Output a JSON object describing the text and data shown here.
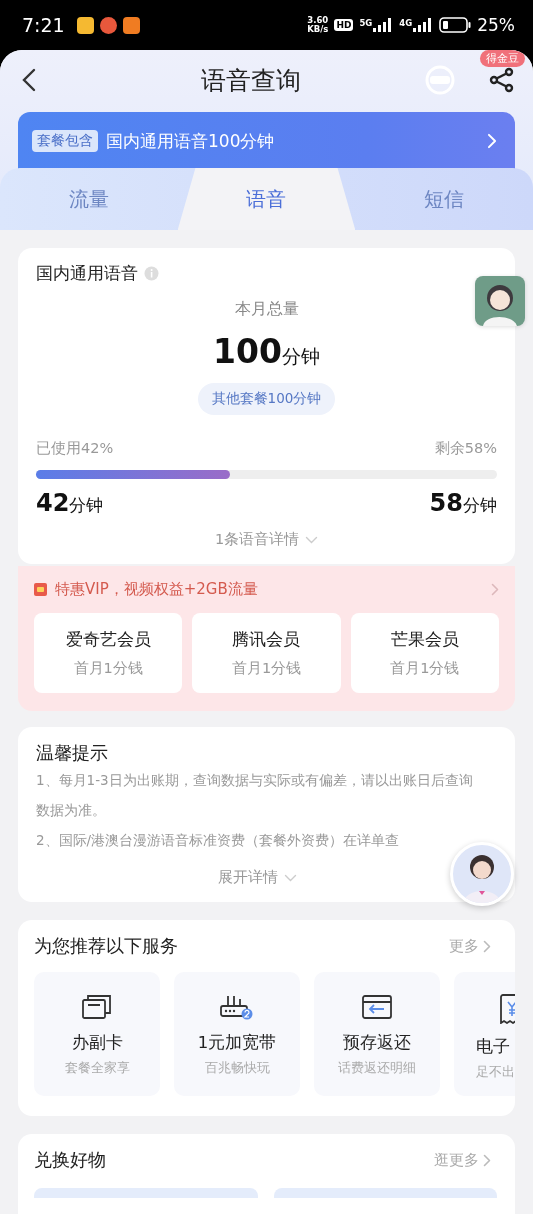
{
  "status_bar": {
    "time": "7:21",
    "speed_value": "3.60",
    "speed_unit": "KB/s",
    "hd": "HD",
    "networks": [
      "5G",
      "4G"
    ],
    "battery": "25%"
  },
  "header": {
    "title": "语音查询",
    "badge": "得金豆"
  },
  "banner": {
    "tag": "套餐包含",
    "text": "国内通用语音100分钟"
  },
  "tabs": [
    {
      "label": "流量",
      "selected": false
    },
    {
      "label": "语音",
      "selected": true
    },
    {
      "label": "短信",
      "selected": false
    }
  ],
  "usage": {
    "title": "国内通用语音",
    "total_label": "本月总量",
    "total_value": "100",
    "total_unit": "分钟",
    "bubble": "其他套餐100分钟",
    "used_label": "已使用42%",
    "left_label": "剩余58%",
    "level": 0.42,
    "used_value": "42",
    "used_unit": "分钟",
    "left_value": "58",
    "left_unit": "分钟",
    "details": "1条语音详情"
  },
  "promo": {
    "title": "特惠VIP，视频权益+2GB流量",
    "offers": [
      {
        "name": "爱奇艺会员",
        "price": "首月1分钱"
      },
      {
        "name": "腾讯会员",
        "price": "首月1分钱"
      },
      {
        "name": "芒果会员",
        "price": "首月1分钱"
      }
    ]
  },
  "tips": {
    "title": "温馨提示",
    "lines": [
      "1、每月1-3日为出账期，查询数据与实际或有偏差，请以出账日后查询数据为准。",
      "2、国际/港澳台漫游语音标准资费（套餐外资费）在详单查"
    ],
    "expand": "展开详情"
  },
  "services": {
    "title": "为您推荐以下服务",
    "more": "更多",
    "items": [
      {
        "kind": "cards",
        "name": "办副卡",
        "sub": "套餐全家享"
      },
      {
        "kind": "router",
        "name": "1元加宽带",
        "sub": "百兆畅快玩"
      },
      {
        "kind": "refund",
        "name": "预存返还",
        "sub": "话费返还明细"
      },
      {
        "kind": "receipt",
        "name": "电子",
        "sub": "足不出"
      }
    ]
  },
  "exchange": {
    "title": "兑换好物",
    "more": "逛更多"
  }
}
